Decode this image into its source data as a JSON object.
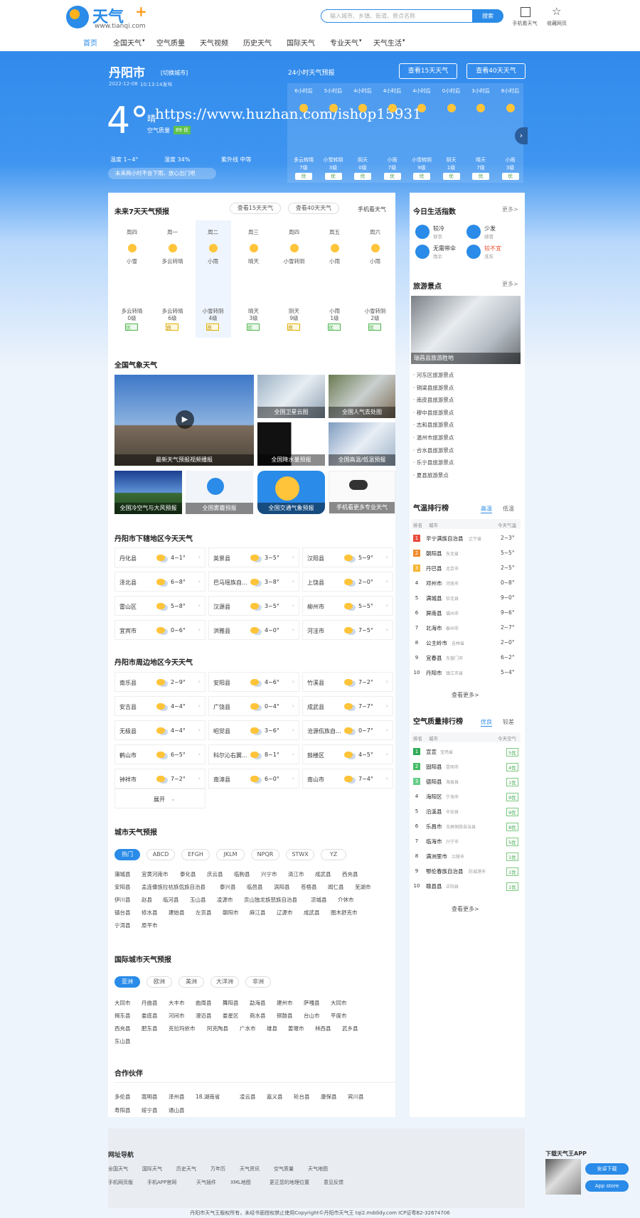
{
  "header": {
    "logo_text": "天气",
    "logo_plus": "+",
    "logo_url": "www.tianqi.com",
    "search_placeholder": "输入城市、乡镇、街道、景点名称",
    "search_btn": "搜索",
    "mobile": "手机看天气",
    "fav": "收藏网页"
  },
  "nav": [
    "首页",
    "全国天气",
    "空气质量",
    "天气视频",
    "历史天气",
    "国际天气",
    "专业天气",
    "天气生活"
  ],
  "city": {
    "name": "丹阳市",
    "switch": "[切换城市]",
    "date": "2022-12-08",
    "pub": "10:13:14发布",
    "temp": "4°",
    "cond": "晴",
    "aq_label": "空气质量",
    "aq_val": "89 优",
    "hum_t": "温度 1~4°",
    "hum": "湿度 34%",
    "uv": "紫外线 中等",
    "notice": "未来两小时不会下雨，放心出门吧"
  },
  "hourly": {
    "title": "24小时天气预报",
    "btn15": "查看15天天气",
    "btn40": "查看40天天气",
    "watermark": "https://www.huzhan.com/ishop15931",
    "hours": [
      "6小时后",
      "5小时后",
      "4小时后",
      "4小时后",
      "4小时后",
      "0小时后",
      "3小时后",
      "8小时后"
    ],
    "wind": [
      [
        "多云转晴",
        "7级"
      ],
      [
        "小雪转阴",
        "3级"
      ],
      [
        "阴天",
        "0级"
      ],
      [
        "小雨",
        "7级"
      ],
      [
        "小雪转阴",
        "9级"
      ],
      [
        "阴天",
        "1级"
      ],
      [
        "晴天",
        "7级"
      ],
      [
        "小雨",
        "3级"
      ]
    ],
    "aqi": "优"
  },
  "week": {
    "title": "未来7天天气预报",
    "btn15": "查看15天天气",
    "btn40": "查看40天天气",
    "mobile": "手机看天气",
    "days": [
      {
        "d": "周四",
        "c": "小雪",
        "w": "多云转晴",
        "l": "0级",
        "q": "优"
      },
      {
        "d": "周一",
        "c": "多云转晴",
        "w": "多云转晴",
        "l": "6级",
        "q": "良"
      },
      {
        "d": "周二",
        "c": "小雨",
        "w": "小雪转阴",
        "l": "4级",
        "q": "良"
      },
      {
        "d": "周三",
        "c": "晴天",
        "w": "晴天",
        "l": "3级",
        "q": "优"
      },
      {
        "d": "周四",
        "c": "小雪转阴",
        "w": "阴天",
        "l": "9级",
        "q": "良"
      },
      {
        "d": "周五",
        "c": "小雨",
        "w": "小雨",
        "l": "1级",
        "q": "优"
      },
      {
        "d": "周六",
        "c": "小雨",
        "w": "小雪转阴",
        "l": "2级",
        "q": "优"
      }
    ]
  },
  "national": {
    "title": "全国气象天气",
    "items": [
      "最新天气预报视频播报",
      "全国卫星云图",
      "全国人气去处图",
      "全国降水量预报",
      "全国高温/低温预报",
      "全国冷空气与大风预报",
      "全国雾霾预报",
      "全国交通气象预报",
      "手机看更多专业天气"
    ]
  },
  "districts": {
    "title": "丹阳市下辖地区今天天气",
    "rows": [
      [
        "丹化县",
        "4~1°",
        "英景县",
        "3~5°",
        "汉阳县",
        "5~9°"
      ],
      [
        "泽北县",
        "6~8°",
        "巴马瑶族自...",
        "3~8°",
        "上饶县",
        "2~0°"
      ],
      [
        "雷山区",
        "5~8°",
        "汉源县",
        "3~5°",
        "柳州市",
        "5~5°"
      ],
      [
        "宜宾市",
        "0~6°",
        "洪雅县",
        "4~0°",
        "河洼市",
        "7~5°"
      ]
    ]
  },
  "nearby": {
    "title": "丹阳市周边地区今天天气",
    "rows": [
      [
        "南乐县",
        "2~9°",
        "安阳县",
        "4~6°",
        "竹溪县",
        "7~2°"
      ],
      [
        "安吉县",
        "4~4°",
        "广饶县",
        "0~4°",
        "成武县",
        "7~7°"
      ],
      [
        "无极县",
        "4~4°",
        "昭觉县",
        "3~6°",
        "沧源佤族自...",
        "0~7°"
      ],
      [
        "鹤山市",
        "6~5°",
        "科尔沁右翼...",
        "8~1°",
        "鼓楼区",
        "4~5°"
      ],
      [
        "钟祥市",
        "7~2°",
        "南漳县",
        "6~0°",
        "南山市",
        "7~4°"
      ]
    ],
    "more": "展开"
  },
  "city_weather": {
    "title": "城市天气预报",
    "tabs": [
      "热门",
      "ABCD",
      "EFGH",
      "JKLM",
      "NPQR",
      "STWX",
      "YZ"
    ],
    "rows": [
      [
        "蒲城县",
        "宜黄河南市",
        "泰化县",
        "庆云县",
        "临朐县",
        "兴宁市",
        "清江市",
        "成武县",
        "西充县"
      ],
      [
        "安阳县",
        "孟连傣族拉祜族佤族自治县",
        "泰兴县",
        "临邑县",
        "涡阳县",
        "苍梧县",
        "闻仁县",
        "芜湖市"
      ],
      [
        "伊川县",
        "赵县",
        "临河县",
        "玉山县",
        "凌源市",
        "贡山独龙族怒族自治县",
        "凉城县",
        "介休市"
      ],
      [
        "镇台县",
        "修水县",
        "建始县",
        "左贡县",
        "朝阳市",
        "麻江县",
        "辽源市",
        "成武县",
        "图木舒克市"
      ],
      [
        "宁洱县",
        "原平市"
      ]
    ]
  },
  "intl": {
    "title": "国际城市天气预报",
    "tabs": [
      "亚洲",
      "欧洲",
      "美洲",
      "大洋洲",
      "非洲"
    ],
    "rows": [
      [
        "大同市",
        "丹曲县",
        "大丰市",
        "曲周县",
        "舞阳县",
        "勐海县",
        "建州市",
        "萨嘎县",
        "大同市"
      ],
      [
        "揭东县",
        "娄底县",
        "河间市",
        "澄迈县",
        "娄星区",
        "商水县",
        "铜鼓县",
        "台山市",
        "平度市"
      ],
      [
        "西充县",
        "肥东县",
        "克拉玛依市",
        "阿克陶县",
        "广水市",
        "雄县",
        "姜堰市",
        "林西县",
        "武乡县"
      ],
      [
        "东山县"
      ]
    ]
  },
  "partners": {
    "title": "合作伙伴",
    "rows": [
      [
        "多伦县",
        "嵩明县",
        "泽州县",
        "18.湖南省",
        "凌云县",
        "嘉义县",
        "轮台县",
        "康保县",
        "宾川县"
      ],
      [
        "寿阳县",
        "绥宁县",
        "通山县"
      ]
    ]
  },
  "life": {
    "title": "今日生活指数",
    "more": "更多>",
    "items": [
      [
        "较冷",
        "穿衣"
      ],
      [
        "少发",
        "感冒"
      ],
      [
        "无需带伞",
        "雨伞"
      ],
      [
        "较不宜",
        "洗车"
      ]
    ]
  },
  "travel": {
    "title": "旅游景点",
    "more": "更多>",
    "photo": "瑞昌县旅游胜地",
    "list": [
      "河东区旅游景点",
      "铜梁县旅游景点",
      "南皮县旅游景点",
      "穆中县旅游景点",
      "志和县旅游景点",
      "温州市旅游景点",
      "合水县旅游景点",
      "乐宁县旅游景点",
      "夏县旅游景点"
    ]
  },
  "temp_rank": {
    "title": "气温排行榜",
    "tabs": [
      "高温",
      "低温"
    ],
    "cols": [
      "排名",
      "城市",
      "今天气温"
    ],
    "rows": [
      [
        "辛宁满族自治县",
        "辽宁省",
        "2~3°"
      ],
      [
        "朝阳县",
        "东北省",
        "5~5°"
      ],
      [
        "丹巴县",
        "北京市",
        "2~5°"
      ],
      [
        "邓州市",
        "河南市",
        "0~8°"
      ],
      [
        "满城县",
        "钦北县",
        "9~0°"
      ],
      [
        "屏南县",
        "福州市",
        "9~6°"
      ],
      [
        "北海市",
        "泰州市",
        "2~7°"
      ],
      [
        "公主岭市",
        "吉林省",
        "2~0°"
      ],
      [
        "宜春县",
        "东营门市",
        "6~2°"
      ],
      [
        "丹阳市",
        "镇江市县",
        "5~4°"
      ]
    ],
    "more": "查看更多>"
  },
  "aq_rank": {
    "title": "空气质量排行榜",
    "tabs": [
      "优良",
      "较差"
    ],
    "cols": [
      "排名",
      "城市",
      "今天空气"
    ],
    "rows": [
      [
        "宣宣",
        "宝鸡省",
        "5优"
      ],
      [
        "固阳县",
        "昆明市",
        "4优"
      ],
      [
        "德阳县",
        "海县县",
        "1优"
      ],
      [
        "海阳区",
        "宁海市",
        "9优"
      ],
      [
        "沿溪县",
        "辛安县",
        "9优"
      ],
      [
        "乐昌市",
        "玉屏侗族自治县",
        "8优"
      ],
      [
        "临海市",
        "兴宁市",
        "5优"
      ],
      [
        "满洲里市",
        "兰陵市",
        "1优"
      ],
      [
        "鄂伦春族自治县",
        "防城港市",
        "1优"
      ],
      [
        "赣县县",
        "正阳县",
        "1优"
      ]
    ],
    "more": "查看更多>"
  },
  "footer": {
    "nav_title": "网址导航",
    "links1": [
      "全国天气",
      "国际天气",
      "历史天气",
      "万年历",
      "天气资讯",
      "空气质量",
      "天气地图"
    ],
    "links2": [
      "手机网页版",
      "手机APP官网",
      "天气插件",
      "XML地图",
      "更正您的地理位置",
      "意见反馈"
    ],
    "app_title": "下载天气王APP",
    "android": "安卓下载",
    "ios": "App store",
    "copyright": "丹阳市天气王版权所有，未经书面授权禁止使用Copyright©丹阳市天气王 tqi2.mddidy.com ICP证粤B2-32674706"
  }
}
